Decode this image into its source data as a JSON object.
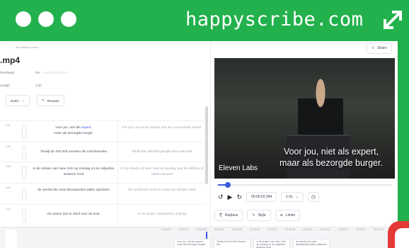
{
  "frame": {
    "domain": "happyscribe.com"
  },
  "editor": {
    "saved_status": "All changes saved",
    "filename": ".mp4",
    "meta": [
      {
        "label": "Proofread",
        "value": "0%"
      },
      {
        "label": "Length",
        "value": "1:20"
      }
    ],
    "language_button": "Dutch",
    "rename_button": "Rename",
    "rows": [
      {
        "time": "0:00",
        "source": "Voor jou, niet als expert, maar als bezorgde burger.",
        "source_highlight": "expert",
        "target": "For you, not as an expert, but as a concerned citizen."
      },
      {
        "time": "0:03",
        "source": "Terwijl de 400.000 mensen die marcheerden",
        "target": "While the 400,000 people who marched"
      },
      {
        "time": "0:06",
        "source": "in de straten van New York op zondag en de miljarden anderen rond",
        "target": "in the streets of New York on Sunday and the billions of others around"
      },
      {
        "time": "0:10",
        "source": "de wereld die onze klimaatcrisis willen oplossen",
        "target": "the world who want to solve our climate crisis"
      },
      {
        "time": "0:14",
        "source": "Als acteur doe ik alsof voor de kost.",
        "target": "As an actor, I pretend for a living."
      }
    ]
  },
  "player": {
    "share_button": "Share",
    "subtitle_line1": "Voor jou, niet als expert,",
    "subtitle_line2": "maar als bezorgde burger.",
    "video_logo": "Eleven Labs",
    "progress_percent": 5,
    "timecode": "00:00:02.344",
    "speed": "1.0x",
    "toolbar": {
      "replace": "Replace",
      "style": "Style",
      "limits": "Limits"
    }
  },
  "timeline": {
    "ticks": [
      "00:00:01",
      "00:00:02",
      "00:00:03",
      "00:00:04",
      "00:00:05",
      "00:00:06",
      "00:00:07",
      "00:00:08",
      "00:00:09",
      "00:00:10",
      "00:00:11",
      "00:00:12",
      "00:00:13",
      "00:00:14"
    ],
    "clips": [
      "Voor jou, niet als expert, maar als bezorgde burger.",
      "Terwijl de 400.000 mensen die",
      "in de straten van New York op zondag en de miljarden anderen rond",
      "de wereld die onze klimaatcrisis willen oplossen"
    ]
  },
  "colors": {
    "frame_green": "#22b14c",
    "accent_blue": "#3b5bdb",
    "corner_red": "#e53935"
  }
}
